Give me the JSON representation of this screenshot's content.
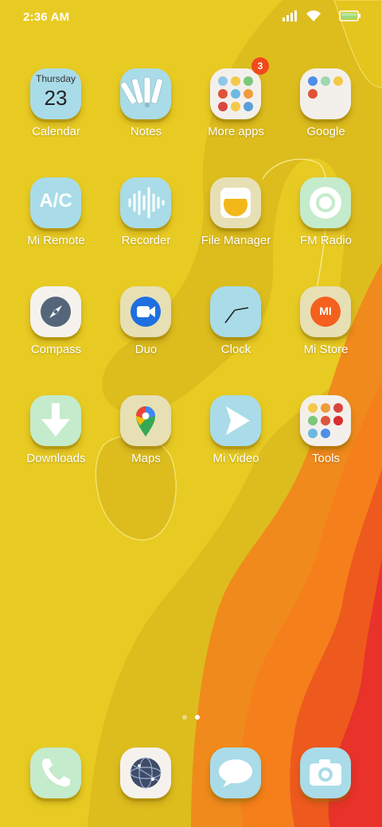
{
  "status_bar": {
    "time": "2:36 AM",
    "icons": [
      "signal-icon",
      "wifi-icon",
      "battery-icon"
    ]
  },
  "home": {
    "rows": [
      [
        {
          "label": "Calendar",
          "icon": "calendar-icon",
          "day_name": "Thursday",
          "day_number": "23"
        },
        {
          "label": "Notes",
          "icon": "notes-icon"
        },
        {
          "label": "More apps",
          "icon": "folder-icon",
          "badge": "3"
        },
        {
          "label": "Google",
          "icon": "folder-icon"
        }
      ],
      [
        {
          "label": "Mi Remote",
          "icon": "remote-icon",
          "glyph": "A/C"
        },
        {
          "label": "Recorder",
          "icon": "recorder-icon"
        },
        {
          "label": "File Manager",
          "icon": "file-manager-icon"
        },
        {
          "label": "FM Radio",
          "icon": "radio-icon"
        }
      ],
      [
        {
          "label": "Compass",
          "icon": "compass-icon"
        },
        {
          "label": "Duo",
          "icon": "duo-icon"
        },
        {
          "label": "Clock",
          "icon": "clock-icon"
        },
        {
          "label": "Mi Store",
          "icon": "mi-store-icon",
          "glyph": "MI"
        }
      ],
      [
        {
          "label": "Downloads",
          "icon": "download-icon"
        },
        {
          "label": "Maps",
          "icon": "maps-icon"
        },
        {
          "label": "Mi Video",
          "icon": "video-icon"
        },
        {
          "label": "Tools",
          "icon": "folder-icon"
        }
      ]
    ]
  },
  "pager": {
    "page_count": 2,
    "current_page": 2
  },
  "dock": [
    "phone-icon",
    "browser-icon",
    "messages-icon",
    "camera-icon"
  ],
  "colors": {
    "wallpaper_yellow": "#E8CB22",
    "orange": "#F08A1C",
    "red": "#E8322A",
    "icon_blue": "#A9DCE8",
    "icon_beige": "#E7E0B5",
    "icon_green": "#C4EBCB",
    "badge": "#F04A1C"
  }
}
